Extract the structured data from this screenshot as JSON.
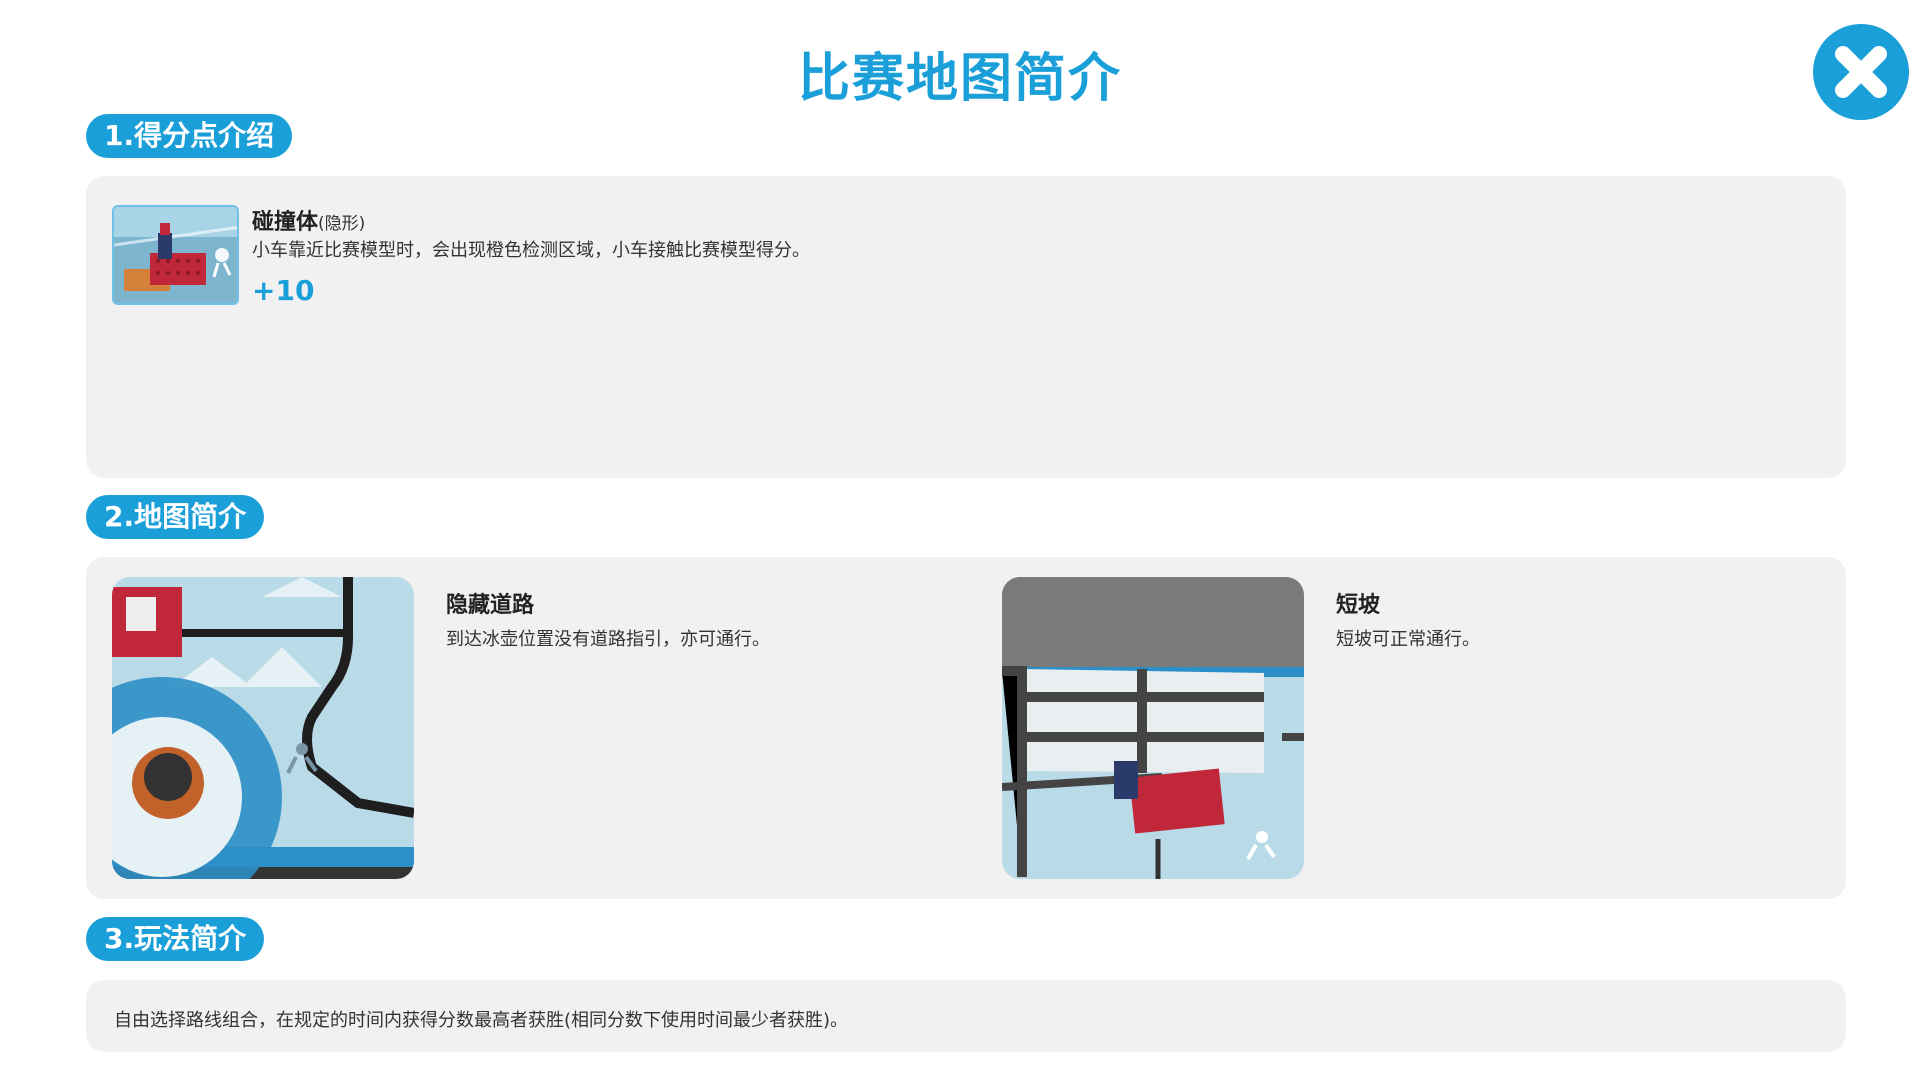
{
  "title": "比赛地图简介",
  "close_icon": "close-icon",
  "colors": {
    "accent": "#1a9fd9",
    "panel": "#f1f1f1"
  },
  "sections": [
    {
      "label": "1.得分点介绍",
      "items": [
        {
          "name": "碰撞体",
          "tag": "(隐形)",
          "desc": "小车靠近比赛模型时，会出现橙色检测区域，小车接触比赛模型得分。",
          "score": "+10"
        }
      ]
    },
    {
      "label": "2.地图简介",
      "items": [
        {
          "name": "隐藏道路",
          "desc": "到达冰壶位置没有道路指引，亦可通行。"
        },
        {
          "name": "短坡",
          "desc": "短坡可正常通行。"
        }
      ]
    },
    {
      "label": "3.玩法简介",
      "text": "自由选择路线组合，在规定的时间内获得分数最高者获胜(相同分数下使用时间最少者获胜)。"
    }
  ]
}
